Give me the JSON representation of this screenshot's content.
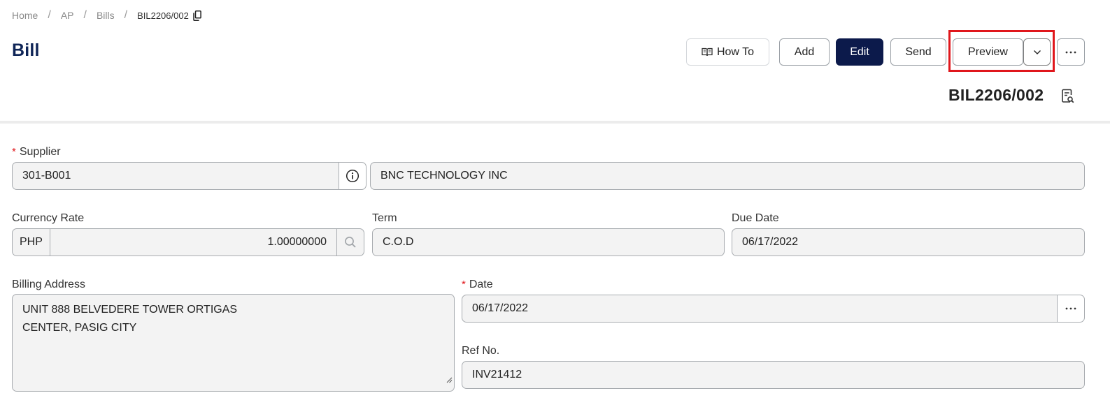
{
  "breadcrumb": {
    "items": [
      "Home",
      "AP",
      "Bills"
    ],
    "current": "BIL2206/002"
  },
  "header": {
    "title": "Bill",
    "document_number": "BIL2206/002",
    "buttons": {
      "how_to": "How To",
      "add": "Add",
      "edit": "Edit",
      "send": "Send",
      "preview": "Preview"
    }
  },
  "form": {
    "supplier": {
      "label": "Supplier",
      "code": "301-B001",
      "name": "BNC TECHNOLOGY INC"
    },
    "currency_rate": {
      "label": "Currency Rate",
      "currency": "PHP",
      "rate": "1.00000000"
    },
    "term": {
      "label": "Term",
      "value": "C.O.D"
    },
    "due_date": {
      "label": "Due Date",
      "value": "06/17/2022"
    },
    "billing_address": {
      "label": "Billing Address",
      "lines": [
        "UNIT 888 BELVEDERE TOWER ORTIGAS",
        "CENTER, PASIG CITY"
      ]
    },
    "date": {
      "label": "Date",
      "value": "06/17/2022"
    },
    "ref_no": {
      "label": "Ref No.",
      "value": "INV21412"
    }
  },
  "icons": {
    "copy": "copy-icon",
    "book": "book-icon",
    "chevron": "chevron-down-icon",
    "more": "more-icon",
    "doc_search": "document-search-icon",
    "info": "info-icon",
    "search": "search-icon"
  },
  "colors": {
    "primary": "#0c1a4b",
    "title": "#0f2557",
    "required": "#e0171c",
    "highlight": "#e0171c",
    "field_bg": "#f3f3f3"
  }
}
